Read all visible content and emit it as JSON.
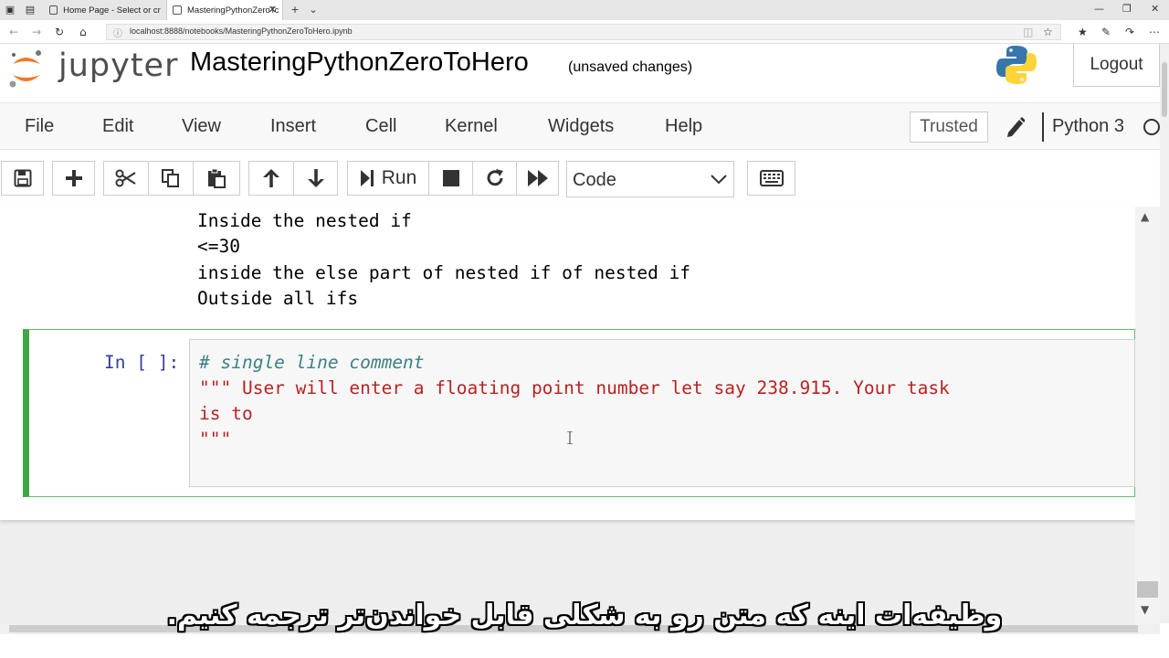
{
  "browser": {
    "tabs": [
      {
        "title": "Home Page - Select or creat"
      },
      {
        "title": "MasteringPythonZeroTc"
      }
    ],
    "url": "localhost:8888/notebooks/MasteringPythonZeroToHero.ipynb"
  },
  "header": {
    "logo_text": "jupyter",
    "notebook_name": "MasteringPythonZeroToHero",
    "save_status": "(unsaved changes)",
    "logout_label": "Logout"
  },
  "menu": {
    "items": [
      "File",
      "Edit",
      "View",
      "Insert",
      "Cell",
      "Kernel",
      "Widgets",
      "Help"
    ],
    "trusted_label": "Trusted",
    "kernel_name": "Python 3"
  },
  "toolbar": {
    "run_label": "Run",
    "cell_type": "Code"
  },
  "output": {
    "lines": [
      "Inside the nested if",
      "<=30",
      "inside the else part of nested if of nested if",
      "Outside all ifs"
    ]
  },
  "cell": {
    "prompt": "In [ ]:",
    "code": {
      "comment": "# single line comment",
      "string_line1": "\"\"\" User will enter a floating point number let say 238.915. Your task",
      "string_line2": "is to",
      "string_line3": "\"\"\""
    }
  },
  "subtitle": "وظیفه‌ات اینه که متن رو به شکلی قابل خواندن‌تر ترجمه کنیم."
}
